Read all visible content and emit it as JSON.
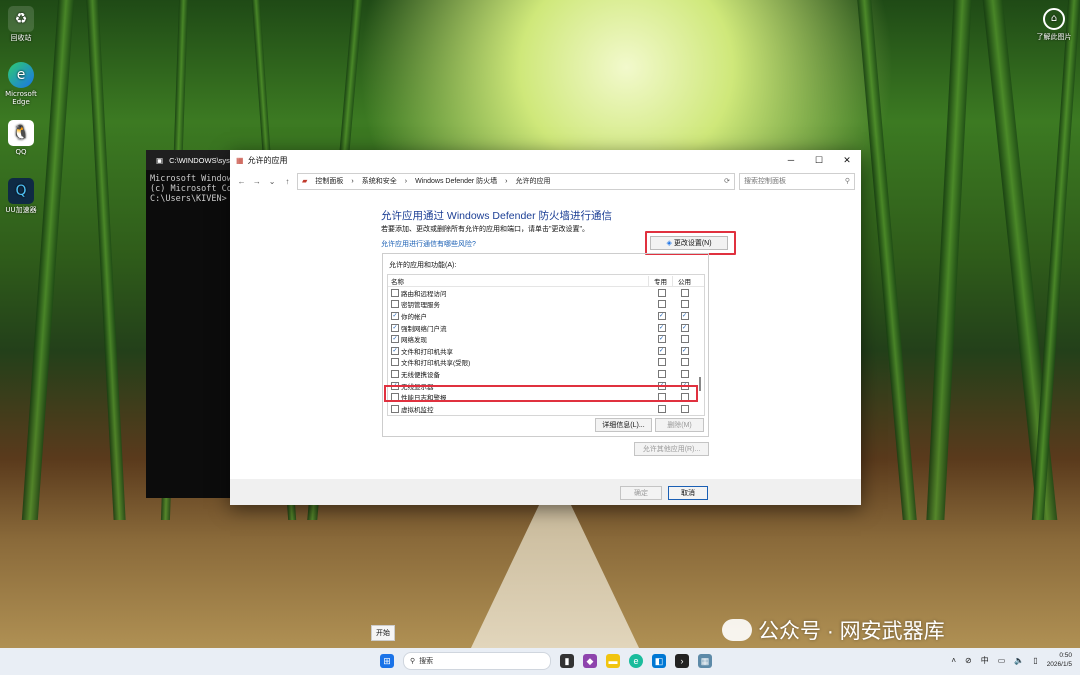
{
  "desktop": {
    "icons": [
      {
        "label": "回收站",
        "icon": "recycle-bin-icon"
      },
      {
        "label": "Microsoft Edge",
        "icon": "edge-icon"
      },
      {
        "label": "QQ",
        "icon": "qq-icon"
      },
      {
        "label": "UU加速器",
        "icon": "uu-accelerator-icon"
      }
    ],
    "top_right": {
      "label": "了解此图片",
      "icon": "info-camera-icon"
    },
    "watermark": "公众号 · 网安武器库",
    "start_tooltip": "开始"
  },
  "cmd": {
    "title": "C:\\WINDOWS\\syste",
    "lines": [
      "Microsoft Window",
      "(c) Microsoft Co",
      "",
      "C:\\Users\\KIVEN>"
    ]
  },
  "dialog": {
    "title": "允许的应用",
    "breadcrumb": [
      "控制面板",
      "系统和安全",
      "Windows Defender 防火墙",
      "允许的应用"
    ],
    "search_placeholder": "搜索控制面板",
    "heading": "允许应用通过 Windows Defender 防火墙进行通信",
    "description": "若要添加、更改或删除所有允许的应用和端口，请单击\"更改设置\"。",
    "risk_link": "允许应用进行通信有哪些风险?",
    "change_settings": "更改设置(N)",
    "group_label": "允许的应用和功能(A):",
    "columns": {
      "name": "名称",
      "private": "专用",
      "public": "公用"
    },
    "rows": [
      {
        "name": "路由和远程访问",
        "enabled": false,
        "private": false,
        "public": false
      },
      {
        "name": "密钥管理服务",
        "enabled": false,
        "private": false,
        "public": false
      },
      {
        "name": "你的帐户",
        "enabled": true,
        "private": true,
        "public": true
      },
      {
        "name": "强制网络门户流",
        "enabled": true,
        "private": true,
        "public": true
      },
      {
        "name": "网络发现",
        "enabled": true,
        "private": true,
        "public": false
      },
      {
        "name": "文件和打印机共享",
        "enabled": true,
        "private": true,
        "public": true
      },
      {
        "name": "文件和打印机共享(受限)",
        "enabled": false,
        "private": false,
        "public": false
      },
      {
        "name": "无线便携设备",
        "enabled": false,
        "private": false,
        "public": false
      },
      {
        "name": "无线显示器",
        "enabled": true,
        "private": true,
        "public": true
      },
      {
        "name": "性能日志和警报",
        "enabled": false,
        "private": false,
        "public": false
      },
      {
        "name": "虚拟机监控",
        "enabled": false,
        "private": false,
        "public": false
      }
    ],
    "details_button": "详细信息(L)...",
    "delete_button": "删除(M)",
    "allow_other_button": "允许其他应用(R)...",
    "ok_button": "确定",
    "cancel_button": "取消"
  },
  "taskbar": {
    "search_label": "搜索",
    "ime": "中",
    "time": "0:50",
    "date": "2026/1/5"
  },
  "colors": {
    "highlight": "#e0313f",
    "heading": "#1c3f95",
    "link": "#1a5fb4"
  }
}
